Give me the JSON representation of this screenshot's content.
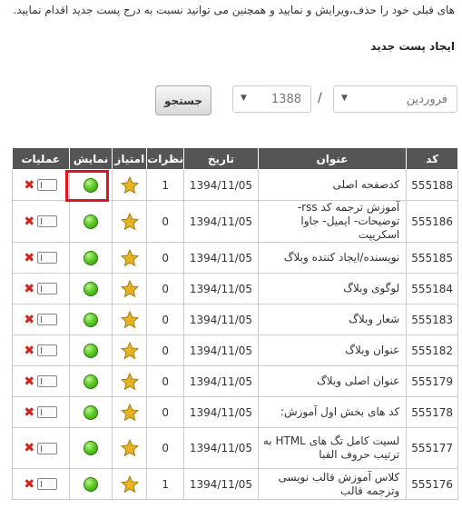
{
  "intro_text": "های قبلی خود را حذف،ویرایش و نمایید و همچنین می توانید نسبت به درج پست جدید اقدام نمایید.",
  "heading": "ایجاد پست جدید",
  "filters": {
    "month": "فروردین",
    "separator": "/",
    "year": "1388",
    "search_label": "جستجو"
  },
  "table": {
    "headers": {
      "code": "کد",
      "title": "عنوان",
      "date": "تاریخ",
      "comments": "نظرات",
      "rating": "امتیاز",
      "display": "نمایش",
      "actions": "عملیات"
    },
    "rows": [
      {
        "code": "555188",
        "title": "کدصفحه اصلی",
        "date": "1394/11/05",
        "comments": "1"
      },
      {
        "code": "555186",
        "title": "آموزش ترجمه کد rss- توضیحات- ایمیل- جاوا اسکریپت",
        "date": "1394/11/05",
        "comments": "0"
      },
      {
        "code": "555185",
        "title": "نویسنده/ایجاد کننده وبلاگ",
        "date": "1394/11/05",
        "comments": "0"
      },
      {
        "code": "555184",
        "title": "لوگوی وبلاگ",
        "date": "1394/11/05",
        "comments": "0"
      },
      {
        "code": "555183",
        "title": "شعار وبلاگ",
        "date": "1394/11/05",
        "comments": "0"
      },
      {
        "code": "555182",
        "title": "عنوان وبلاگ",
        "date": "1394/11/05",
        "comments": "0"
      },
      {
        "code": "555179",
        "title": "عنوان اصلی وبلاگ",
        "date": "1394/11/05",
        "comments": "0"
      },
      {
        "code": "555178",
        "title": "کد های بخش اول آموزش:",
        "date": "1394/11/05",
        "comments": "0"
      },
      {
        "code": "555177",
        "title": "لسیت کامل تگ های HTML به ترتیب حروف الفبا",
        "date": "1394/11/05",
        "comments": "0"
      },
      {
        "code": "555176",
        "title": "کلاس آموزش قالب نویسی وترجمه قالب",
        "date": "1394/11/05",
        "comments": "1"
      }
    ]
  },
  "colors": {
    "header_bg": "#555555",
    "highlight": "#e0141e",
    "delete": "#d8201b",
    "display_on": "#5fcc2a",
    "star": "#e6b422"
  }
}
